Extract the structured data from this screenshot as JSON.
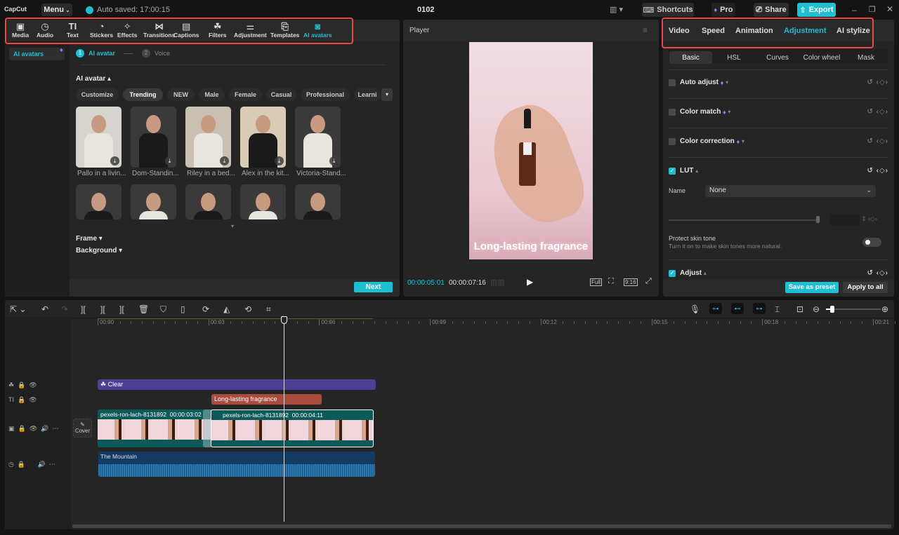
{
  "app": {
    "logo": "CapCut",
    "menu_label": "Menu",
    "autosave": "Auto saved: 17:00:15",
    "project_title": "0102",
    "shortcuts_label": "Shortcuts",
    "pro_label": "Pro",
    "share_label": "Share",
    "export_label": "Export"
  },
  "toolbar": {
    "items": [
      {
        "label": "Media",
        "icon": "▣"
      },
      {
        "label": "Audio",
        "icon": "◷"
      },
      {
        "label": "Text",
        "icon": "TI"
      },
      {
        "label": "Stickers",
        "icon": "◔"
      },
      {
        "label": "Effects",
        "icon": "✧"
      },
      {
        "label": "Transitions",
        "icon": "⋈"
      },
      {
        "label": "Captions",
        "icon": "▤"
      },
      {
        "label": "Filters",
        "icon": "☘"
      },
      {
        "label": "Adjustment",
        "icon": "⚌"
      },
      {
        "label": "Templates",
        "icon": "⎘"
      },
      {
        "label": "AI avatars",
        "icon": "◙",
        "active": true
      }
    ]
  },
  "sidebar": {
    "item": "AI avatars"
  },
  "steps": {
    "step1_num": "1",
    "step1": "AI avatar",
    "step2_num": "2",
    "step2": "Voice"
  },
  "avatar_section": {
    "title": "AI avatar ▴",
    "chips": [
      "Customize",
      "Trending",
      "NEW",
      "Male",
      "Female",
      "Casual",
      "Professional",
      "Learni"
    ],
    "selected_chip": "Trending",
    "avatars": [
      {
        "caption": "Pallo in a livin...",
        "color": "#d7d4cf"
      },
      {
        "caption": "Dom-Standin...",
        "color": "#3a3a3a"
      },
      {
        "caption": "Riley in a bed...",
        "color": "#c9c0b3"
      },
      {
        "caption": "Alex in the kit...",
        "color": "#d8ccb5"
      },
      {
        "caption": "Victoria-Stand...",
        "color": "#3a3a3a"
      },
      {
        "caption": "",
        "color": "#3a3a3a"
      },
      {
        "caption": "",
        "color": "#3a3a3a"
      },
      {
        "caption": "",
        "color": "#3a3a3a"
      },
      {
        "caption": "",
        "color": "#3a3a3a"
      },
      {
        "caption": "",
        "color": "#3a3a3a"
      }
    ],
    "frame_label": "Frame ▾",
    "background_label": "Background ▾",
    "next_label": "Next"
  },
  "player": {
    "title": "Player",
    "overlay_text": "Long-lasting fragrance",
    "current_time": "00:00:05:01",
    "total_time": "00:00:07:16",
    "full_label": "Full",
    "ratio_label": "9:16"
  },
  "right_panel": {
    "tabs": [
      "Video",
      "Speed",
      "Animation",
      "Adjustment",
      "AI stylize"
    ],
    "active_tab": "Adjustment",
    "subtabs": [
      "Basic",
      "HSL",
      "Curves",
      "Color wheel",
      "Mask"
    ],
    "active_subtab": "Basic",
    "auto_adjust": "Auto adjust",
    "color_match": "Color match",
    "color_correction": "Color correction",
    "lut": "LUT",
    "name_label": "Name",
    "name_value": "None",
    "protect_title": "Protect skin tone",
    "protect_desc": "Turn it on to make skin tones more natural.",
    "adjust": "Adjust",
    "save_preset": "Save as preset",
    "apply_all": "Apply to all"
  },
  "timeline": {
    "ruler": [
      "00:00",
      "00:03",
      "00:06",
      "00:09",
      "00:12",
      "00:15",
      "00:18",
      "00:21"
    ],
    "filter_clip": "Clear",
    "text_clip": "Long-lasting fragrance",
    "video_clip1": "pexels-ron-lach-8131892",
    "video_clip1_dur": "00:00:03:02",
    "video_clip2": "pexels-ron-lach-8131892",
    "video_clip2_dur": "00:00:04:11",
    "audio_clip": "The Mountain",
    "cover_label": "Cover",
    "zoom_level": 0.12
  },
  "colors": {
    "accent": "#1fbfd3",
    "filter_clip": "#4b3f96",
    "text_clip": "#a94c3d",
    "video_clip": "#0b5a5a",
    "audio_clip": "#123a62"
  }
}
